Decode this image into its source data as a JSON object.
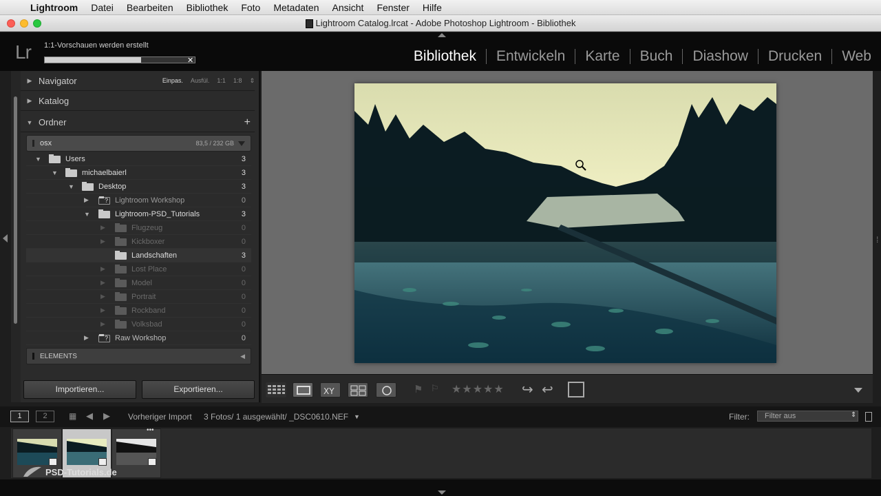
{
  "menubar": {
    "app": "Lightroom",
    "items": [
      "Datei",
      "Bearbeiten",
      "Bibliothek",
      "Foto",
      "Metadaten",
      "Ansicht",
      "Fenster",
      "Hilfe"
    ]
  },
  "window": {
    "title": "Lightroom Catalog.lrcat - Adobe Photoshop Lightroom - Bibliothek"
  },
  "identity": {
    "logo": "Lr",
    "progress_text": "1:1-Vorschauen werden erstellt",
    "progress": 0.64
  },
  "modules": [
    "Bibliothek",
    "Entwickeln",
    "Karte",
    "Buch",
    "Diashow",
    "Drucken",
    "Web"
  ],
  "left": {
    "navigator": {
      "label": "Navigator",
      "opts": [
        "Einpas.",
        "Ausfül.",
        "1:1",
        "1:8"
      ]
    },
    "catalog": "Katalog",
    "folders": "Ordner",
    "volume": {
      "name": "osx",
      "size": "83,5 / 232 GB"
    },
    "tree": [
      {
        "label": "Users",
        "count": "3"
      },
      {
        "label": "michaelbaierl",
        "count": "3"
      },
      {
        "label": "Desktop",
        "count": "3"
      },
      {
        "label": "Lightroom Workshop",
        "count": "0"
      },
      {
        "label": "Lightroom-PSD_Tutorials",
        "count": "3"
      },
      {
        "label": "Flugzeug",
        "count": "0"
      },
      {
        "label": "Kickboxer",
        "count": "0"
      },
      {
        "label": "Landschaften",
        "count": "3"
      },
      {
        "label": "Lost Place",
        "count": "0"
      },
      {
        "label": "Model",
        "count": "0"
      },
      {
        "label": "Portrait",
        "count": "0"
      },
      {
        "label": "Rockband",
        "count": "0"
      },
      {
        "label": "Volksbad",
        "count": "0"
      },
      {
        "label": "Raw Workshop",
        "count": "0"
      }
    ],
    "elements": "ELEMENTS",
    "import": "Importieren...",
    "export": "Exportieren..."
  },
  "filmbar": {
    "mon1": "1",
    "mon2": "2",
    "source": "Vorheriger Import",
    "info": "3 Fotos/ 1 ausgewählt/ _DSC0610.NEF",
    "filter_label": "Filter:",
    "filter_value": "Filter aus"
  },
  "watermark": "PSD-Tutorials.de"
}
